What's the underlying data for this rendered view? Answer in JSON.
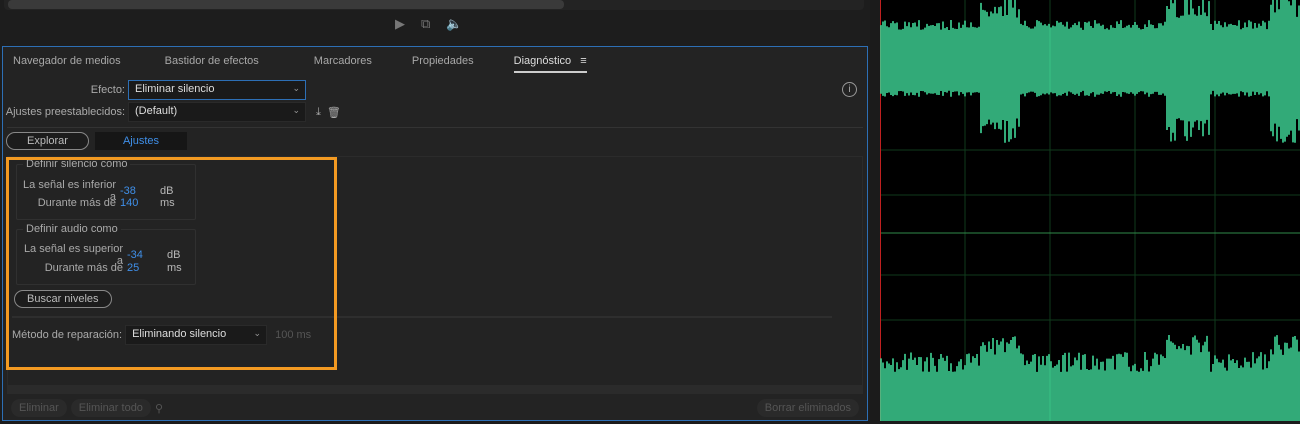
{
  "transport": {
    "play_icon": "play-icon",
    "export_icon": "export-icon",
    "volume_icon": "volume-icon"
  },
  "tabs": [
    "Navegador de medios",
    "Bastidor de efectos",
    "Marcadores",
    "Propiedades",
    "Diagnóstico"
  ],
  "effect": {
    "label": "Efecto:",
    "value": "Eliminar silencio"
  },
  "presets": {
    "label": "Ajustes preestablecidos:",
    "value": "(Default)"
  },
  "modes": {
    "explore": "Explorar",
    "settings": "Ajustes"
  },
  "silence": {
    "title": "Definir silencio como",
    "signal_label": "La señal es inferior a",
    "signal_value": "-38",
    "signal_unit": "dB",
    "duration_label": "Durante más de",
    "duration_value": "140",
    "duration_unit": "ms"
  },
  "audio": {
    "title": "Definir audio como",
    "signal_label": "La señal es superior a",
    "signal_value": "-34",
    "signal_unit": "dB",
    "duration_label": "Durante más de",
    "duration_value": "25",
    "duration_unit": "ms"
  },
  "find_levels": "Buscar niveles",
  "repair": {
    "label": "Método de reparación:",
    "value": "Eliminando silencio",
    "ms": "100 ms"
  },
  "footer": {
    "remove": "Eliminar",
    "remove_all": "Eliminar todo",
    "clear_removed": "Borrar eliminados"
  },
  "colors": {
    "accent": "#2d6fb5",
    "highlight": "#f39a22",
    "waveform": "#3fd597",
    "value": "#3f8fe8"
  }
}
